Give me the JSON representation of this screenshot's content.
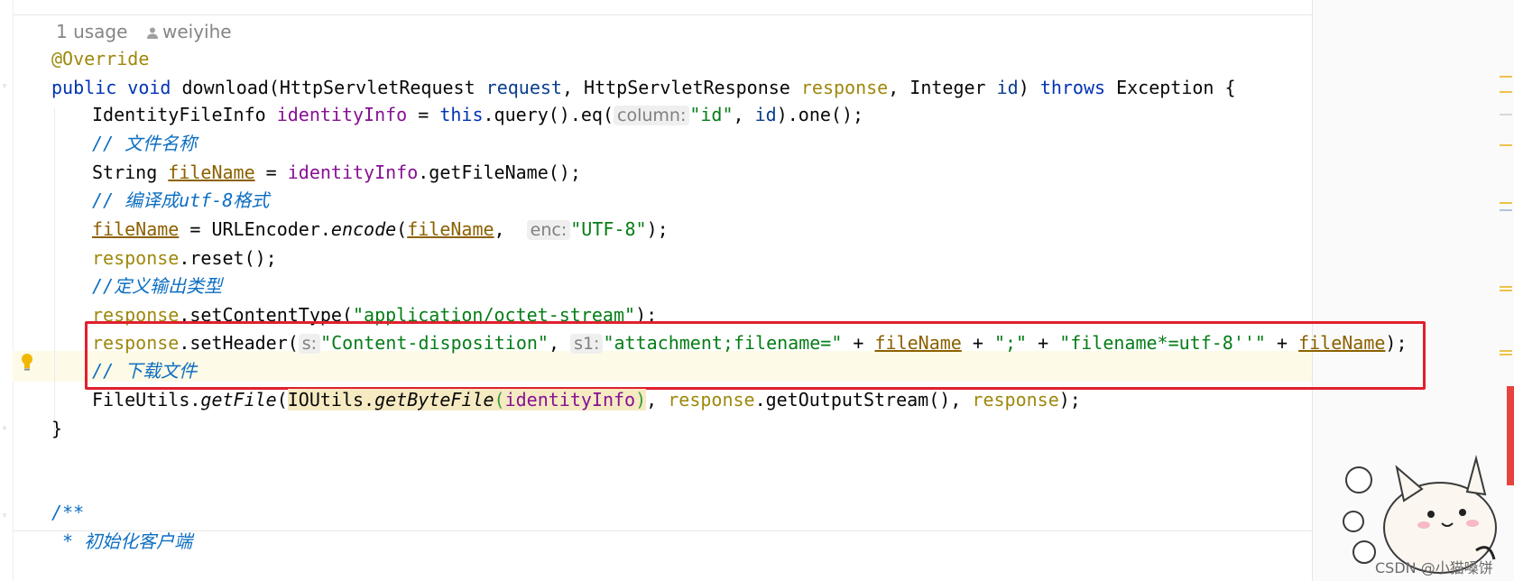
{
  "editor": {
    "usage_hint": "1 usage",
    "author_hint": "weiyihe",
    "lines": {
      "annotation": "@Override",
      "sig_public": "public",
      "sig_void": "void",
      "sig_name": " download(HttpServletRequest ",
      "sig_request": "request",
      "sig_mid": ", HttpServletResponse ",
      "sig_response": "response",
      "sig_mid2": ", Integer ",
      "sig_id": "id",
      "sig_close": ") ",
      "sig_throws": "throws",
      "sig_tail": " Exception {",
      "l1_type": "IdentityFileInfo ",
      "l1_var": "identityInfo",
      "l1_eq": " = ",
      "l1_this": "this",
      "l1_call": ".query().eq(",
      "l1_hint": "column:",
      "l1_str": "\"id\"",
      "l1_mid": ", ",
      "l1_id": "id",
      "l1_end": ").one();",
      "c1": "// 文件名称",
      "l2_type": "String ",
      "l2_var": "fileName",
      "l2_eq": " = ",
      "l2_obj": "identityInfo",
      "l2_end": ".getFileName();",
      "c2": "// 编译成utf-8格式",
      "l3_var": "fileName",
      "l3_mid": " = URLEncoder.",
      "l3_method": "encode",
      "l3_open": "(",
      "l3_arg": "fileName",
      "l3_comma": ", ",
      "l3_hint": "enc:",
      "l3_str": "\"UTF-8\"",
      "l3_end": ");",
      "l4_obj": "response",
      "l4_end": ".reset();",
      "c3": "//定义输出类型",
      "l5_obj": "response",
      "l5_call": ".setContentType(",
      "l5_str": "\"application/octet-stream\"",
      "l5_end": ");",
      "l6_obj": "response",
      "l6_call": ".setHeader(",
      "l6_hint1": "s:",
      "l6_str1": "\"Content-disposition\"",
      "l6_comma": ", ",
      "l6_hint2": "s1:",
      "l6_str2": "\"attachment;filename=\"",
      "l6_plus1": " + ",
      "l6_var1": "fileName",
      "l6_plus2": " + ",
      "l6_str3": "\";\"",
      "l6_plus3": " + ",
      "l6_str4": "\"filename*=utf-8''\"",
      "l6_plus4": " + ",
      "l6_var2": "fileName",
      "l6_end": ");",
      "c4": "// 下载文件",
      "l7_a": "FileUtils.",
      "l7_m1": "getFile",
      "l7_open": "(",
      "l7_b": "IOUtils.",
      "l7_m2": "getByteFile",
      "l7_open2": "(",
      "l7_arg": "identityInfo",
      "l7_close2": ")",
      "l7_comma": ", ",
      "l7_obj": "response",
      "l7_call": ".getOutputStream()",
      "l7_comma2": ", ",
      "l7_obj2": "response",
      "l7_end": ");",
      "close_brace": "}",
      "doc_open": "/**",
      "doc_line": " * 初始化客户端"
    }
  },
  "watermark": "CSDN @小猫嗓饼",
  "colors": {
    "keyword": "#0033b3",
    "string": "#067d17",
    "annotation": "#9e880d",
    "field": "#871094",
    "comment": "#0c6ec2",
    "highlight_box": "#e0202e"
  },
  "icons": [
    "user-icon",
    "lightbulb-icon",
    "fold-icon"
  ]
}
